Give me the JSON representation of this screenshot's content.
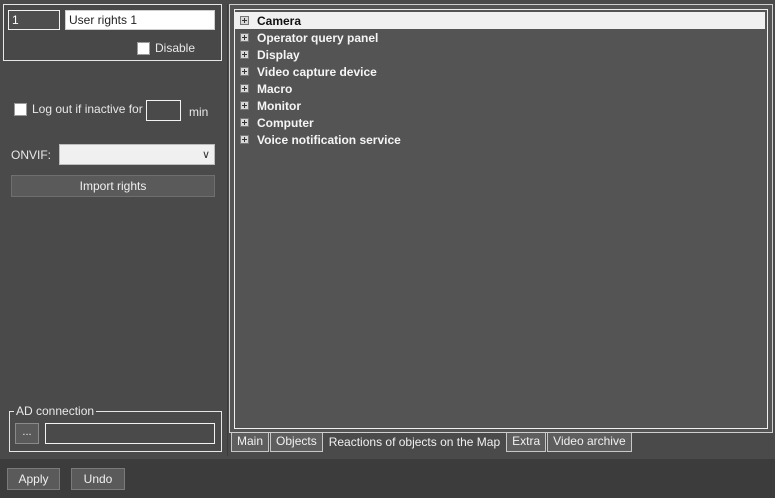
{
  "identity": {
    "id_value": "1",
    "name_value": "User rights 1",
    "disable_label": "Disable"
  },
  "session": {
    "logout_label": "Log out if inactive for",
    "inactive_value": "",
    "min_label": "min"
  },
  "onvif": {
    "label": "ONVIF:",
    "selected": ""
  },
  "import_button": "Import rights",
  "ad": {
    "legend": "AD connection",
    "browse_label": "...",
    "value": ""
  },
  "tree": {
    "items": [
      {
        "label": "Camera",
        "selected": true
      },
      {
        "label": "Operator query panel"
      },
      {
        "label": "Display"
      },
      {
        "label": "Video capture device"
      },
      {
        "label": "Macro"
      },
      {
        "label": "Monitor"
      },
      {
        "label": "Computer"
      },
      {
        "label": "Voice notification service"
      }
    ]
  },
  "tabs": [
    {
      "label": "Main"
    },
    {
      "label": "Objects"
    },
    {
      "label": "Reactions of objects on the Map",
      "active": true
    },
    {
      "label": "Extra"
    },
    {
      "label": "Video archive"
    }
  ],
  "footer": {
    "apply_label": "Apply",
    "undo_label": "Undo"
  }
}
